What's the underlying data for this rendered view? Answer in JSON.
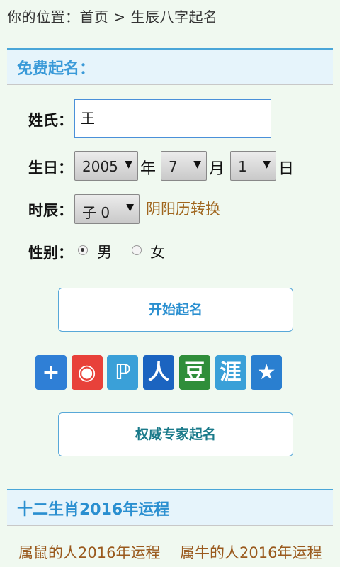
{
  "breadcrumb": "你的位置：首页 > 生辰八字起名",
  "section_free": {
    "title": "免费起名："
  },
  "form": {
    "surname_label": "姓氏",
    "surname_value": "王",
    "birthday_label": "生日",
    "year_value": "2005",
    "year_unit": "年",
    "month_value": "7",
    "month_unit": "月",
    "day_value": "1",
    "day_unit": "日",
    "hour_label": "时辰",
    "hour_value": "子 0",
    "convert_link": "阴阳历转换",
    "gender_label": "性别",
    "gender_male": "男",
    "gender_female": "女",
    "colon": "："
  },
  "buttons": {
    "start": "开始起名",
    "expert": "权威专家起名"
  },
  "share": [
    {
      "name": "plus-icon",
      "glyph": "+",
      "color": "#2f7fd6"
    },
    {
      "name": "weibo-icon",
      "glyph": "◉",
      "color": "#e8413a"
    },
    {
      "name": "tencent-weibo-icon",
      "glyph": "ℙ",
      "color": "#3aa0d8"
    },
    {
      "name": "renren-icon",
      "glyph": "人",
      "color": "#1b64c0"
    },
    {
      "name": "douban-icon",
      "glyph": "豆",
      "color": "#2f8e3a"
    },
    {
      "name": "huaban-icon",
      "glyph": "涯",
      "color": "#3aa0d8"
    },
    {
      "name": "qzone-icon",
      "glyph": "★",
      "color": "#2a7fd0"
    }
  ],
  "section_zodiac": {
    "title": "十二生肖2016年运程"
  },
  "zodiac_links": [
    "属鼠的人2016年运程",
    "属牛的人2016年运程"
  ]
}
